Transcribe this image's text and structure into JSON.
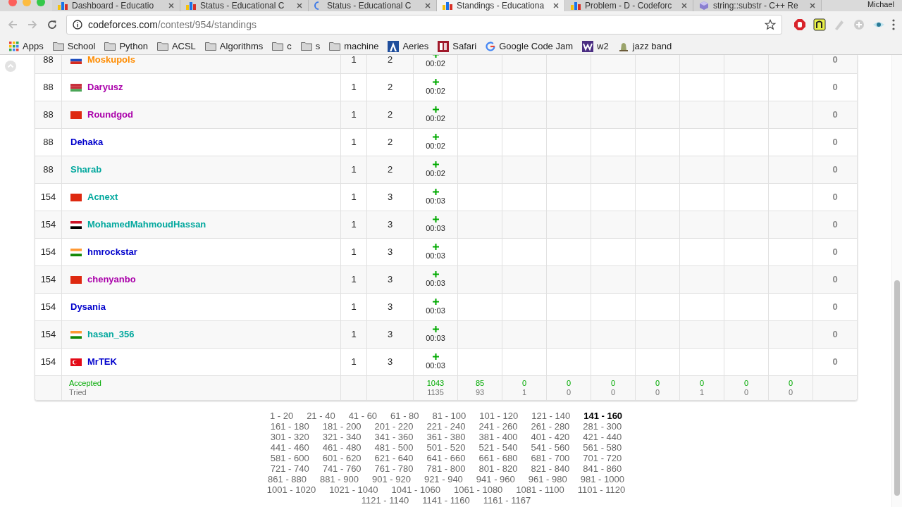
{
  "browser": {
    "tabs": [
      {
        "title": "Dashboard - Educatio",
        "kind": "bars",
        "selected": false
      },
      {
        "title": "Status - Educational C",
        "kind": "bars",
        "selected": false
      },
      {
        "title": "Status - Educational C",
        "kind": "spinner",
        "selected": false
      },
      {
        "title": "Standings - Educationa",
        "kind": "bars",
        "selected": true
      },
      {
        "title": "Problem - D - Codeforc",
        "kind": "bars",
        "selected": false
      },
      {
        "title": "string::substr - C++ Re",
        "kind": "cube",
        "selected": false
      }
    ],
    "profile": "Michael",
    "url_host": "codeforces.com",
    "url_path": "/contest/954/standings",
    "bookmarks": [
      {
        "label": "Apps",
        "kind": "apps"
      },
      {
        "label": "School",
        "kind": "folder"
      },
      {
        "label": "Python",
        "kind": "folder"
      },
      {
        "label": "ACSL",
        "kind": "folder"
      },
      {
        "label": "Algorithms",
        "kind": "folder"
      },
      {
        "label": "c",
        "kind": "folder"
      },
      {
        "label": "s",
        "kind": "folder"
      },
      {
        "label": "machine",
        "kind": "folder"
      },
      {
        "label": "Aeries",
        "kind": "aeries"
      },
      {
        "label": "Safari",
        "kind": "dr"
      },
      {
        "label": "Google Code Jam",
        "kind": "google"
      },
      {
        "label": "w2",
        "kind": "w"
      },
      {
        "label": "jazz band",
        "kind": "bell"
      }
    ]
  },
  "standings": {
    "rows": [
      {
        "rank": "88",
        "kind": "russia",
        "name": "Moskupols",
        "color": "#ff8c00",
        "solved": "1",
        "penalty": "2",
        "time": "00:02",
        "score": "0"
      },
      {
        "rank": "88",
        "kind": "belarus",
        "name": "Daryusz",
        "color": "#aa00aa",
        "solved": "1",
        "penalty": "2",
        "time": "00:02",
        "score": "0"
      },
      {
        "rank": "88",
        "kind": "china",
        "name": "Roundgod",
        "color": "#aa00aa",
        "solved": "1",
        "penalty": "2",
        "time": "00:02",
        "score": "0"
      },
      {
        "rank": "88",
        "kind": "none",
        "name": "Dehaka",
        "color": "#0000cc",
        "solved": "1",
        "penalty": "2",
        "time": "00:02",
        "score": "0"
      },
      {
        "rank": "88",
        "kind": "none",
        "name": "Sharab",
        "color": "#03a89e",
        "solved": "1",
        "penalty": "2",
        "time": "00:02",
        "score": "0"
      },
      {
        "rank": "154",
        "kind": "china",
        "name": "Acnext",
        "color": "#03a89e",
        "solved": "1",
        "penalty": "3",
        "time": "00:03",
        "score": "0"
      },
      {
        "rank": "154",
        "kind": "egypt",
        "name": "MohamedMahmoudHassan",
        "color": "#03a89e",
        "solved": "1",
        "penalty": "3",
        "time": "00:03",
        "score": "0"
      },
      {
        "rank": "154",
        "kind": "india",
        "name": "hmrockstar",
        "color": "#0000cc",
        "solved": "1",
        "penalty": "3",
        "time": "00:03",
        "score": "0"
      },
      {
        "rank": "154",
        "kind": "china",
        "name": "chenyanbo",
        "color": "#aa00aa",
        "solved": "1",
        "penalty": "3",
        "time": "00:03",
        "score": "0"
      },
      {
        "rank": "154",
        "kind": "none",
        "name": "Dysania",
        "color": "#0000cc",
        "solved": "1",
        "penalty": "3",
        "time": "00:03",
        "score": "0"
      },
      {
        "rank": "154",
        "kind": "india",
        "name": "hasan_356",
        "color": "#03a89e",
        "solved": "1",
        "penalty": "3",
        "time": "00:03",
        "score": "0"
      },
      {
        "rank": "154",
        "kind": "turkey",
        "name": "MrTEK",
        "color": "#0000cc",
        "solved": "1",
        "penalty": "3",
        "time": "00:03",
        "score": "0"
      }
    ],
    "footer": {
      "accepted_label": "Accepted",
      "tried_label": "Tried",
      "columns": [
        {
          "accepted": "1043",
          "tried": "1135"
        },
        {
          "accepted": "85",
          "tried": "93"
        },
        {
          "accepted": "0",
          "tried": "1"
        },
        {
          "accepted": "0",
          "tried": "0"
        },
        {
          "accepted": "0",
          "tried": "0"
        },
        {
          "accepted": "0",
          "tried": "0"
        },
        {
          "accepted": "0",
          "tried": "1"
        },
        {
          "accepted": "0",
          "tried": "0"
        },
        {
          "accepted": "0",
          "tried": "0"
        }
      ]
    }
  },
  "pagination": [
    [
      {
        "label": "1 - 20",
        "selected": false
      },
      {
        "label": "21 - 40",
        "selected": false
      },
      {
        "label": "41 - 60",
        "selected": false
      },
      {
        "label": "61 - 80",
        "selected": false
      },
      {
        "label": "81 - 100",
        "selected": false
      },
      {
        "label": "101 - 120",
        "selected": false
      },
      {
        "label": "121 - 140",
        "selected": false
      },
      {
        "label": "141 - 160",
        "selected": true
      }
    ],
    [
      {
        "label": "161 - 180",
        "selected": false
      },
      {
        "label": "181 - 200",
        "selected": false
      },
      {
        "label": "201 - 220",
        "selected": false
      },
      {
        "label": "221 - 240",
        "selected": false
      },
      {
        "label": "241 - 260",
        "selected": false
      },
      {
        "label": "261 - 280",
        "selected": false
      },
      {
        "label": "281 - 300",
        "selected": false
      }
    ],
    [
      {
        "label": "301 - 320",
        "selected": false
      },
      {
        "label": "321 - 340",
        "selected": false
      },
      {
        "label": "341 - 360",
        "selected": false
      },
      {
        "label": "361 - 380",
        "selected": false
      },
      {
        "label": "381 - 400",
        "selected": false
      },
      {
        "label": "401 - 420",
        "selected": false
      },
      {
        "label": "421 - 440",
        "selected": false
      }
    ],
    [
      {
        "label": "441 - 460",
        "selected": false
      },
      {
        "label": "461 - 480",
        "selected": false
      },
      {
        "label": "481 - 500",
        "selected": false
      },
      {
        "label": "501 - 520",
        "selected": false
      },
      {
        "label": "521 - 540",
        "selected": false
      },
      {
        "label": "541 - 560",
        "selected": false
      },
      {
        "label": "561 - 580",
        "selected": false
      }
    ],
    [
      {
        "label": "581 - 600",
        "selected": false
      },
      {
        "label": "601 - 620",
        "selected": false
      },
      {
        "label": "621 - 640",
        "selected": false
      },
      {
        "label": "641 - 660",
        "selected": false
      },
      {
        "label": "661 - 680",
        "selected": false
      },
      {
        "label": "681 - 700",
        "selected": false
      },
      {
        "label": "701 - 720",
        "selected": false
      }
    ],
    [
      {
        "label": "721 - 740",
        "selected": false
      },
      {
        "label": "741 - 760",
        "selected": false
      },
      {
        "label": "761 - 780",
        "selected": false
      },
      {
        "label": "781 - 800",
        "selected": false
      },
      {
        "label": "801 - 820",
        "selected": false
      },
      {
        "label": "821 - 840",
        "selected": false
      },
      {
        "label": "841 - 860",
        "selected": false
      }
    ],
    [
      {
        "label": "861 - 880",
        "selected": false
      },
      {
        "label": "881 - 900",
        "selected": false
      },
      {
        "label": "901 - 920",
        "selected": false
      },
      {
        "label": "921 - 940",
        "selected": false
      },
      {
        "label": "941 - 960",
        "selected": false
      },
      {
        "label": "961 - 980",
        "selected": false
      },
      {
        "label": "981 - 1000",
        "selected": false
      }
    ],
    [
      {
        "label": "1001 - 1020",
        "selected": false
      },
      {
        "label": "1021 - 1040",
        "selected": false
      },
      {
        "label": "1041 - 1060",
        "selected": false
      },
      {
        "label": "1061 - 1080",
        "selected": false
      },
      {
        "label": "1081 - 1100",
        "selected": false
      },
      {
        "label": "1101 - 1120",
        "selected": false
      }
    ],
    [
      {
        "label": "1121 - 1140",
        "selected": false
      },
      {
        "label": "1141 - 1160",
        "selected": false
      },
      {
        "label": "1161 - 1167",
        "selected": false
      }
    ]
  ]
}
